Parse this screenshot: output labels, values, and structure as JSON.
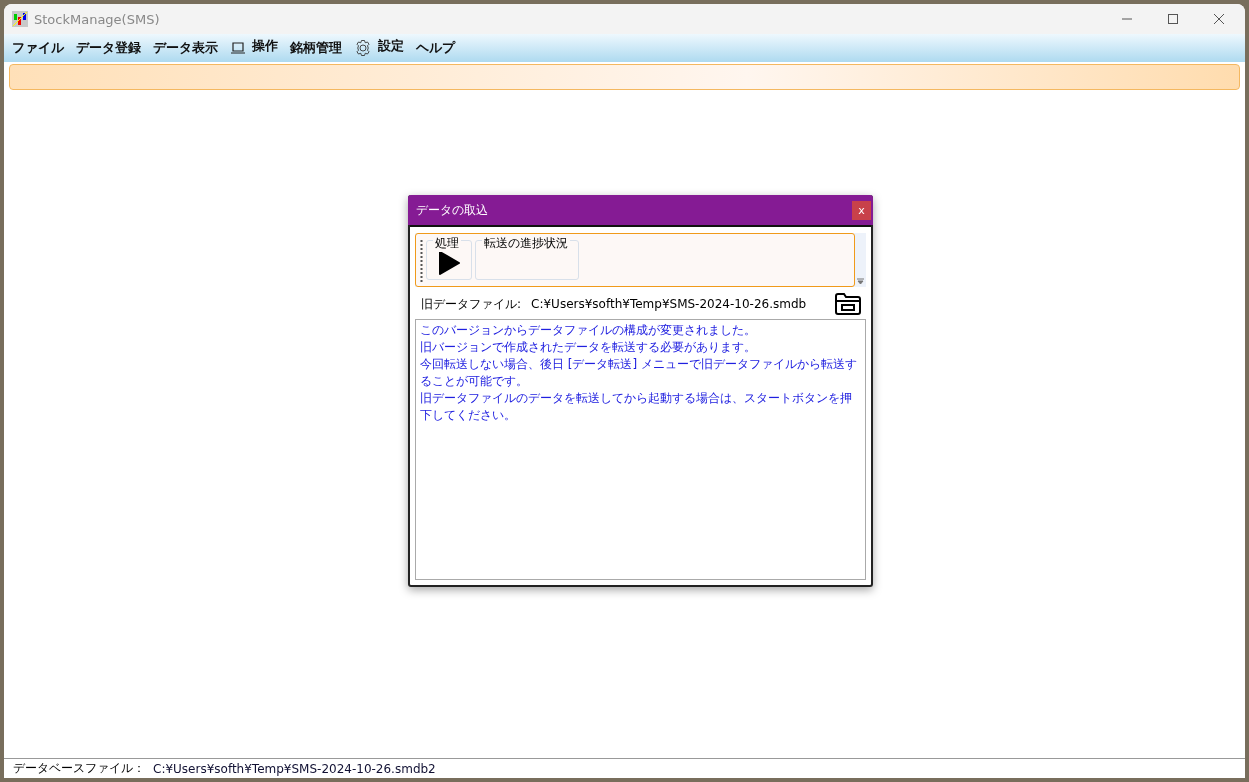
{
  "window": {
    "title": "StockManage(SMS)"
  },
  "menu": [
    {
      "label": "ファイル",
      "kind": "plain"
    },
    {
      "label": "データ登録",
      "kind": "plain"
    },
    {
      "label": "データ表示",
      "kind": "plain"
    },
    {
      "label": "操作",
      "kind": "icon"
    },
    {
      "label": "銘柄管理",
      "kind": "plain"
    },
    {
      "label": "設定",
      "kind": "icon"
    },
    {
      "label": "ヘルプ",
      "kind": "plain"
    }
  ],
  "dialog": {
    "title": "データの取込",
    "close": "x",
    "toolbar": {
      "groups": [
        {
          "label": "処理",
          "kind": "play"
        },
        {
          "label": "転送の進捗状況",
          "kind": "progress"
        }
      ]
    },
    "old_file": {
      "label": "旧データファイル:",
      "value": "C:¥Users¥softh¥Temp¥SMS-2024-10-26.smdb"
    },
    "message": [
      "このバージョンからデータファイルの構成が変更されました。",
      "旧バージョンで作成されたデータを転送する必要があります。",
      "今回転送しない場合、後日 [データ転送] メニューで旧データファイルから転送することが可能です。",
      "旧データファイルのデータを転送してから起動する場合は、スタートボタンを押下してください。"
    ]
  },
  "status_bar": {
    "label": "データベースファイル：",
    "value": "C:¥Users¥softh¥Temp¥SMS-2024-10-26.smdb2"
  }
}
